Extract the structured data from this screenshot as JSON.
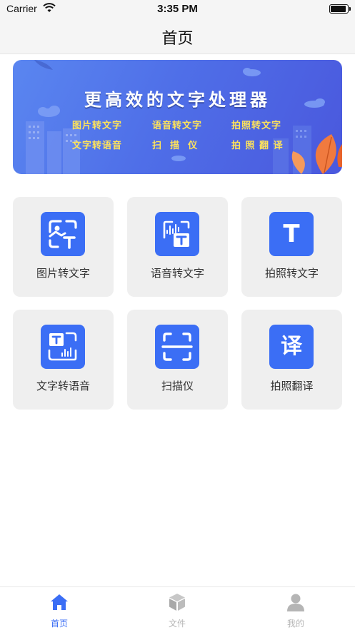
{
  "status_bar": {
    "carrier": "Carrier",
    "time": "3:35 PM",
    "battery_level": 0.95
  },
  "nav": {
    "title": "首页"
  },
  "banner": {
    "headline": "更高效的文字处理器",
    "items": [
      "图片转文字",
      "语音转文字",
      "拍照转文字",
      "文字转语音",
      "扫  描  仪",
      "拍 照 翻 译"
    ]
  },
  "tools": [
    {
      "label": "图片转文字",
      "icon": "image-to-text-icon"
    },
    {
      "label": "语音转文字",
      "icon": "voice-to-text-icon"
    },
    {
      "label": "拍照转文字",
      "icon": "text-t-icon",
      "glyph": "T"
    },
    {
      "label": "文字转语音",
      "icon": "text-to-speech-icon"
    },
    {
      "label": "扫描仪",
      "icon": "scanner-icon"
    },
    {
      "label": "拍照翻译",
      "icon": "translate-icon",
      "glyph": "译"
    }
  ],
  "tab_bar": {
    "tabs": [
      {
        "label": "首页",
        "icon": "home-icon",
        "active": true
      },
      {
        "label": "文件",
        "icon": "cube-icon",
        "active": false
      },
      {
        "label": "我的",
        "icon": "user-icon",
        "active": false
      }
    ],
    "active_color": "#3b6ef5",
    "inactive_color": "#b5b5b5"
  },
  "colors": {
    "accent": "#3b6ef5",
    "banner_text": "#ffe35a",
    "tile_bg": "#efefef"
  }
}
